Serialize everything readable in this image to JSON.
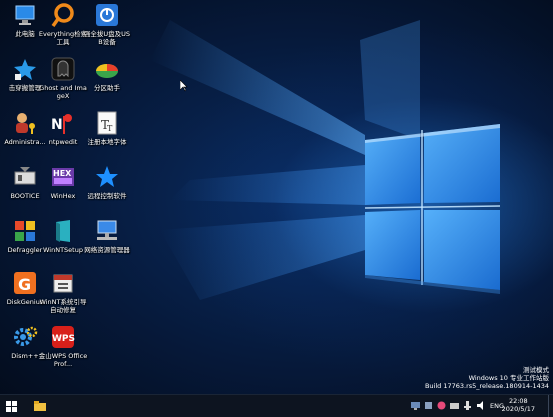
{
  "desktop": {
    "icons": [
      {
        "name": "this-pc",
        "label": "此电脑"
      },
      {
        "name": "everything",
        "label": "Everything检索工具"
      },
      {
        "name": "usb-safe-remove",
        "label": "强全拔U盘及USB设备"
      },
      {
        "name": "bootice-app",
        "label": "击穿搬管理"
      },
      {
        "name": "ghost-imagex",
        "label": "Ghost and ImageX"
      },
      {
        "name": "partition-assistant",
        "label": "分区助手"
      },
      {
        "name": "administrator",
        "label": "Administra..."
      },
      {
        "name": "ntpwedit",
        "label": "ntpwedit"
      },
      {
        "name": "font-tool",
        "label": "注册本地字体"
      },
      {
        "name": "bootice",
        "label": "BOOTICE"
      },
      {
        "name": "winhex",
        "label": "WinHex"
      },
      {
        "name": "remote-tool",
        "label": "远程控制软件"
      },
      {
        "name": "defraggler",
        "label": "Defraggler"
      },
      {
        "name": "winntsetup",
        "label": "WinNTSetup"
      },
      {
        "name": "network-tool",
        "label": "网络资源管理器"
      },
      {
        "name": "diskgenius",
        "label": "DiskGenius"
      },
      {
        "name": "winnt-boot-repair",
        "label": "WinNT系统引导自动修复"
      },
      {
        "name": "dism",
        "label": "Dism++"
      },
      {
        "name": "wps",
        "label": "金山WPS Office Prof..."
      }
    ],
    "watermark": {
      "line1": "测试模式",
      "line2": "Windows 10 专业工作站版",
      "line3": "Build 17763.rs5_release.180914-1434"
    }
  },
  "taskbar": {
    "language": "ENG",
    "time": "22:08",
    "date": "2020/5/17"
  },
  "colors": {
    "taskbar": "#0d1420",
    "accent": "#1e8fff"
  }
}
